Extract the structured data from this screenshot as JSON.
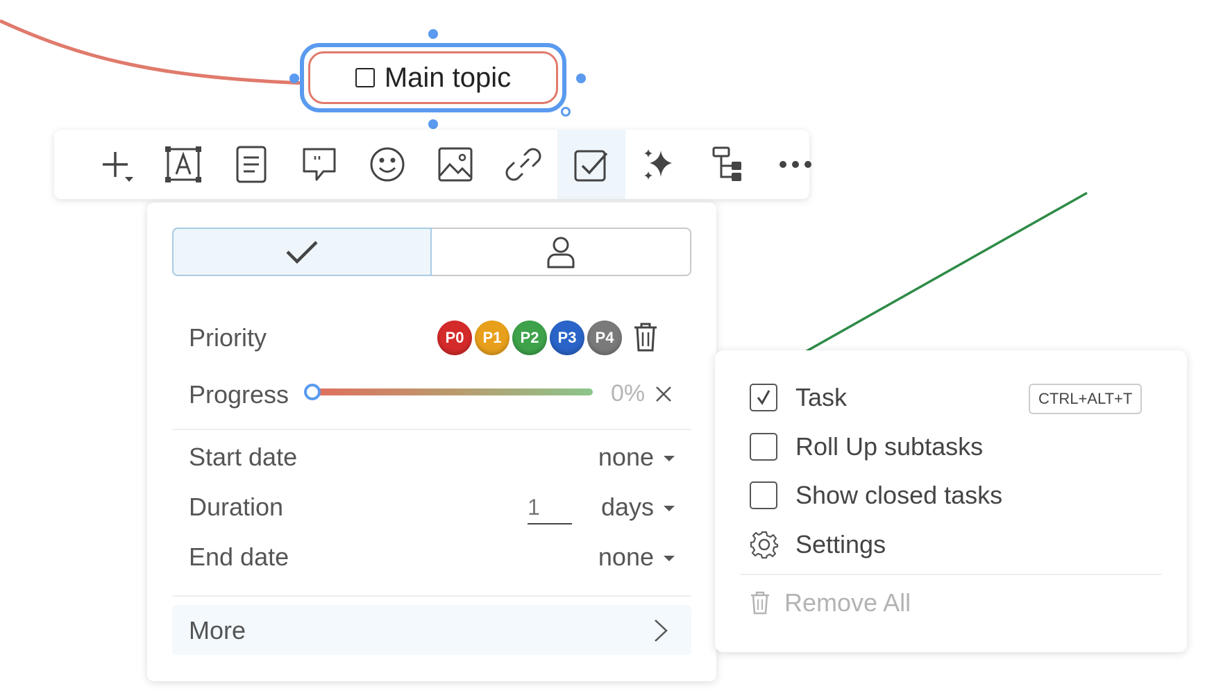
{
  "topic": {
    "title": "Main topic",
    "checked": false
  },
  "toolbar": {
    "items": [
      {
        "icon": "add-icon"
      },
      {
        "icon": "text-box-icon"
      },
      {
        "icon": "note-icon"
      },
      {
        "icon": "comment-icon"
      },
      {
        "icon": "emoji-icon"
      },
      {
        "icon": "image-icon"
      },
      {
        "icon": "link-icon"
      },
      {
        "icon": "task-icon",
        "active": true
      },
      {
        "icon": "ai-sparkle-icon"
      },
      {
        "icon": "structure-icon"
      },
      {
        "icon": "more-icon"
      }
    ]
  },
  "task_panel": {
    "tabs": [
      {
        "icon": "check-icon",
        "active": true
      },
      {
        "icon": "person-icon",
        "active": false
      }
    ],
    "priority": {
      "label": "Priority",
      "levels": [
        {
          "label": "P0",
          "color": "#d42a2a"
        },
        {
          "label": "P1",
          "color": "#e8a01c"
        },
        {
          "label": "P2",
          "color": "#3da24a"
        },
        {
          "label": "P3",
          "color": "#2a64c8"
        },
        {
          "label": "P4",
          "color": "#7a7a7a"
        }
      ]
    },
    "progress": {
      "label": "Progress",
      "value_text": "0%",
      "value": 0
    },
    "start_date": {
      "label": "Start date",
      "value": "none"
    },
    "duration": {
      "label": "Duration",
      "placeholder": "1",
      "unit": "days"
    },
    "end_date": {
      "label": "End date",
      "value": "none"
    },
    "more": {
      "label": "More"
    }
  },
  "task_menu": {
    "items": [
      {
        "label": "Task",
        "checked": true,
        "shortcut": "CTRL+ALT+T"
      },
      {
        "label": "Roll Up subtasks",
        "checked": false
      },
      {
        "label": "Show closed tasks",
        "checked": false
      },
      {
        "label": "Settings",
        "icon": "gear-icon"
      }
    ],
    "remove_all": {
      "label": "Remove All"
    }
  },
  "colors": {
    "accent": "#5a9aef",
    "branch": "#e07a6c",
    "arrow": "#2e8b47"
  }
}
